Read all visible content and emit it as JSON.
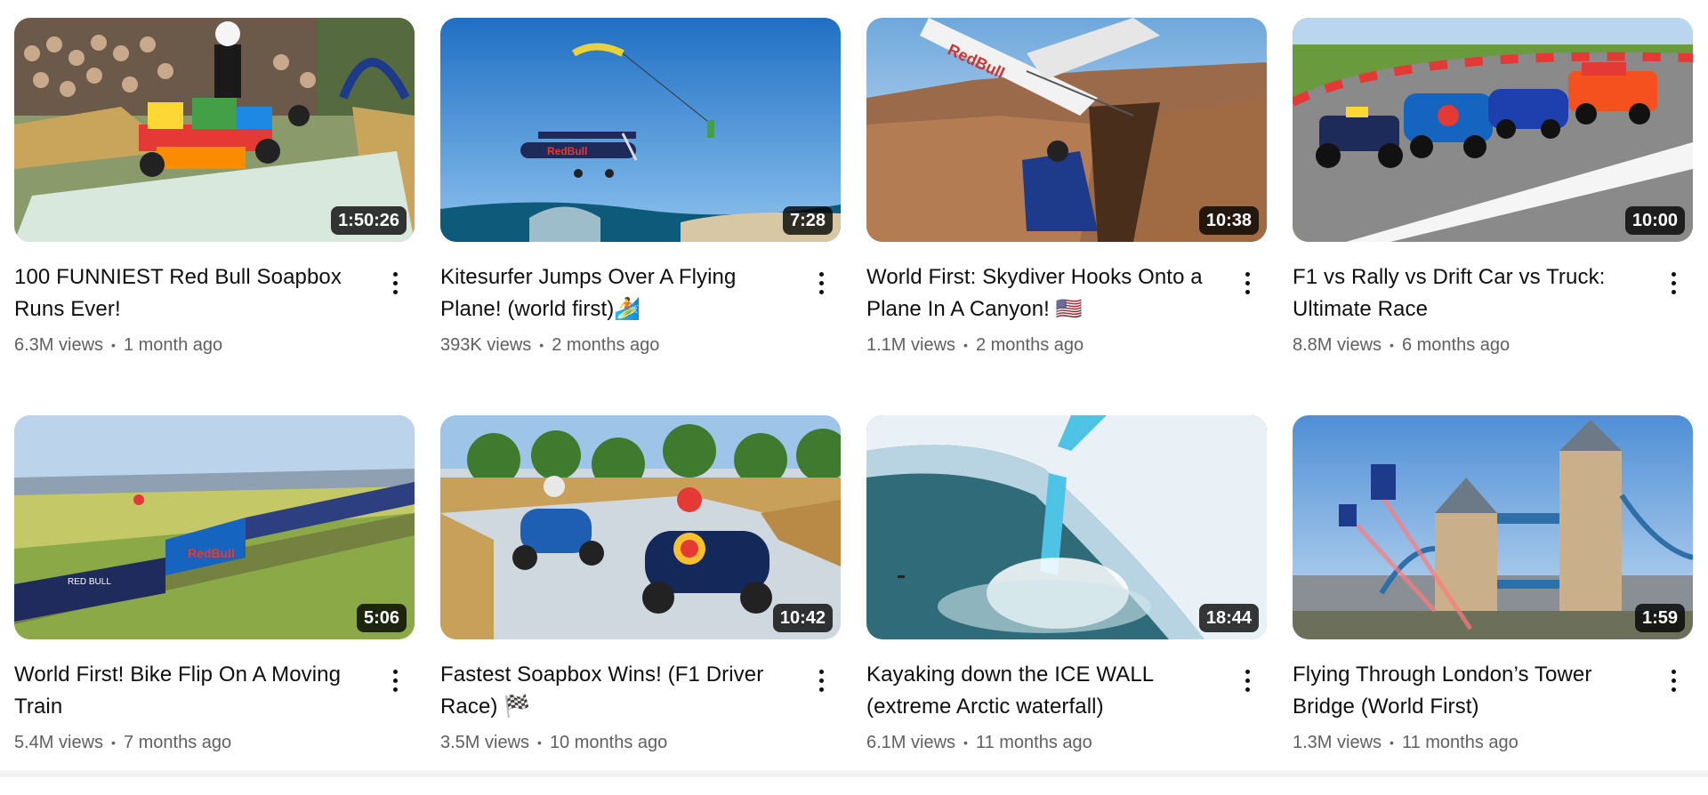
{
  "videos": [
    {
      "title": "100 FUNNIEST Red Bull Soapbox Runs Ever!",
      "duration": "1:50:26",
      "views": "6.3M views",
      "age": "1 month ago",
      "thumb_icon": "soapbox-lego-car-thumbnail"
    },
    {
      "title": "Kitesurfer Jumps Over A Flying Plane! (world first)🏄",
      "duration": "7:28",
      "views": "393K views",
      "age": "2 months ago",
      "thumb_icon": "kitesurfer-plane-thumbnail"
    },
    {
      "title": "World First: Skydiver Hooks Onto a Plane In A Canyon! 🇺🇸",
      "duration": "10:38",
      "views": "1.1M views",
      "age": "2 months ago",
      "thumb_icon": "skydiver-canyon-thumbnail"
    },
    {
      "title": "F1 vs Rally vs Drift Car vs Truck: Ultimate Race",
      "duration": "10:00",
      "views": "8.8M views",
      "age": "6 months ago",
      "thumb_icon": "race-cars-thumbnail"
    },
    {
      "title": "World First! Bike Flip On A Moving Train",
      "duration": "5:06",
      "views": "5.4M views",
      "age": "7 months ago",
      "thumb_icon": "bike-train-thumbnail"
    },
    {
      "title": "Fastest Soapbox Wins! (F1 Driver Race) 🏁",
      "duration": "10:42",
      "views": "3.5M views",
      "age": "10 months ago",
      "thumb_icon": "soapbox-race-thumbnail"
    },
    {
      "title": "Kayaking down the ICE WALL (extreme Arctic waterfall)",
      "duration": "18:44",
      "views": "6.1M views",
      "age": "11 months ago",
      "thumb_icon": "ice-wall-kayak-thumbnail"
    },
    {
      "title": "Flying Through London’s Tower Bridge (World First)",
      "duration": "1:59",
      "views": "1.3M views",
      "age": "11 months ago",
      "thumb_icon": "tower-bridge-thumbnail"
    }
  ],
  "separator": "•",
  "colors": {
    "text": "#0f0f0f",
    "meta": "#606060",
    "duration_bg": "#000000"
  }
}
